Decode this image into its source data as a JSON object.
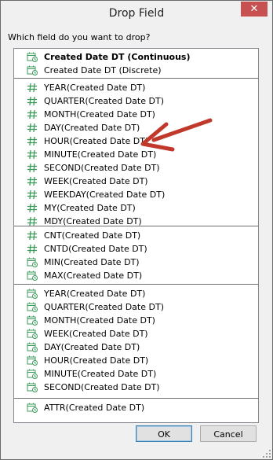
{
  "window": {
    "title": "Drop Field",
    "close_glyph": "✕"
  },
  "prompt": "Which field do you want to drop?",
  "groups": [
    [
      {
        "label": "Created Date DT (Continuous)",
        "icon": "date-continuous-icon",
        "bold": true
      },
      {
        "label": "Created Date DT (Discrete)",
        "icon": "date-continuous-icon",
        "bold": false
      }
    ],
    [
      {
        "label": "YEAR(Created Date DT)",
        "icon": "hash-icon"
      },
      {
        "label": "QUARTER(Created Date DT)",
        "icon": "hash-icon"
      },
      {
        "label": "MONTH(Created Date DT)",
        "icon": "hash-icon"
      },
      {
        "label": "DAY(Created Date DT)",
        "icon": "hash-icon"
      },
      {
        "label": "HOUR(Created Date DT)",
        "icon": "hash-icon"
      },
      {
        "label": "MINUTE(Created Date DT)",
        "icon": "hash-icon"
      },
      {
        "label": "SECOND(Created Date DT)",
        "icon": "hash-icon"
      },
      {
        "label": "WEEK(Created Date DT)",
        "icon": "hash-icon"
      },
      {
        "label": "WEEKDAY(Created Date DT)",
        "icon": "hash-icon"
      },
      {
        "label": "MY(Created Date DT)",
        "icon": "hash-icon"
      },
      {
        "label": "MDY(Created Date DT)",
        "icon": "hash-icon"
      }
    ],
    [
      {
        "label": "CNT(Created Date DT)",
        "icon": "hash-icon"
      },
      {
        "label": "CNTD(Created Date DT)",
        "icon": "hash-icon"
      },
      {
        "label": "MIN(Created Date DT)",
        "icon": "date-continuous-icon"
      },
      {
        "label": "MAX(Created Date DT)",
        "icon": "date-continuous-icon"
      }
    ],
    [
      {
        "label": "YEAR(Created Date DT)",
        "icon": "date-continuous-icon"
      },
      {
        "label": "QUARTER(Created Date DT)",
        "icon": "date-continuous-icon"
      },
      {
        "label": "MONTH(Created Date DT)",
        "icon": "date-continuous-icon"
      },
      {
        "label": "WEEK(Created Date DT)",
        "icon": "date-continuous-icon"
      },
      {
        "label": "DAY(Created Date DT)",
        "icon": "date-continuous-icon"
      },
      {
        "label": "HOUR(Created Date DT)",
        "icon": "date-continuous-icon"
      },
      {
        "label": "MINUTE(Created Date DT)",
        "icon": "date-continuous-icon"
      },
      {
        "label": "SECOND(Created Date DT)",
        "icon": "date-continuous-icon"
      }
    ],
    [
      {
        "label": "ATTR(Created Date DT)",
        "icon": "date-continuous-icon"
      }
    ]
  ],
  "buttons": {
    "ok": "OK",
    "cancel": "Cancel"
  },
  "colors": {
    "icon_green": "#3a9a5a",
    "arrow": "#c0392b",
    "close_red": "#c75050"
  }
}
